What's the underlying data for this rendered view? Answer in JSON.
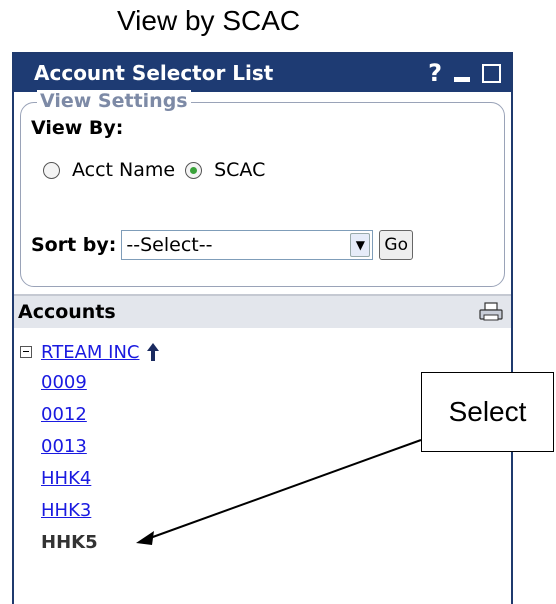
{
  "caption": "View by SCAC",
  "panel": {
    "title": "Account Selector List",
    "help_glyph": "?",
    "settings": {
      "legend": "View Settings",
      "view_by_label": "View By:",
      "options": [
        {
          "label": "Acct Name",
          "checked": false
        },
        {
          "label": "SCAC",
          "checked": true
        }
      ],
      "sort_label": "Sort by:",
      "sort_value": "--Select--",
      "go_label": "Go"
    },
    "accounts": {
      "header": "Accounts",
      "root": "RTEAM INC",
      "children": [
        "0009",
        "0012",
        "0013",
        "HHK4",
        "HHK3"
      ],
      "selected": "HHK5"
    }
  },
  "callout": {
    "text": "Select"
  },
  "colors": {
    "titlebar": "#1e3b73",
    "link": "#1a1ae0",
    "radio_checked": "#3aa23a",
    "legend": "#7d8aa6"
  }
}
